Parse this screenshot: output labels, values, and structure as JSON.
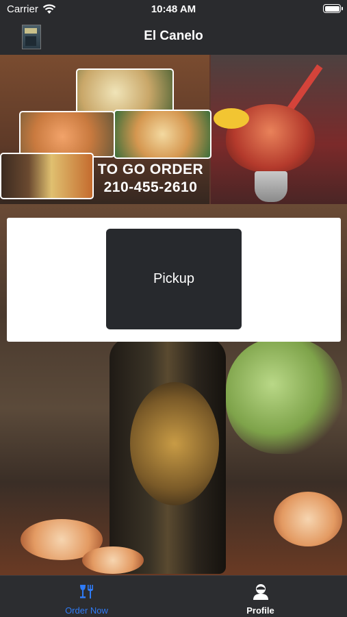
{
  "status_bar": {
    "carrier": "Carrier",
    "time": "10:48 AM"
  },
  "nav": {
    "title": "El Canelo"
  },
  "banner": {
    "line1": "TO GO ORDER",
    "line2": "210-455-2610"
  },
  "card": {
    "pickup_label": "Pickup"
  },
  "tabs": [
    {
      "label": "Order Now",
      "icon": "utensils-icon",
      "active": true
    },
    {
      "label": "Profile",
      "icon": "user-icon",
      "active": false
    }
  ],
  "colors": {
    "accent": "#2f7bf5",
    "bar": "#2c2d30",
    "button": "#27292d"
  }
}
